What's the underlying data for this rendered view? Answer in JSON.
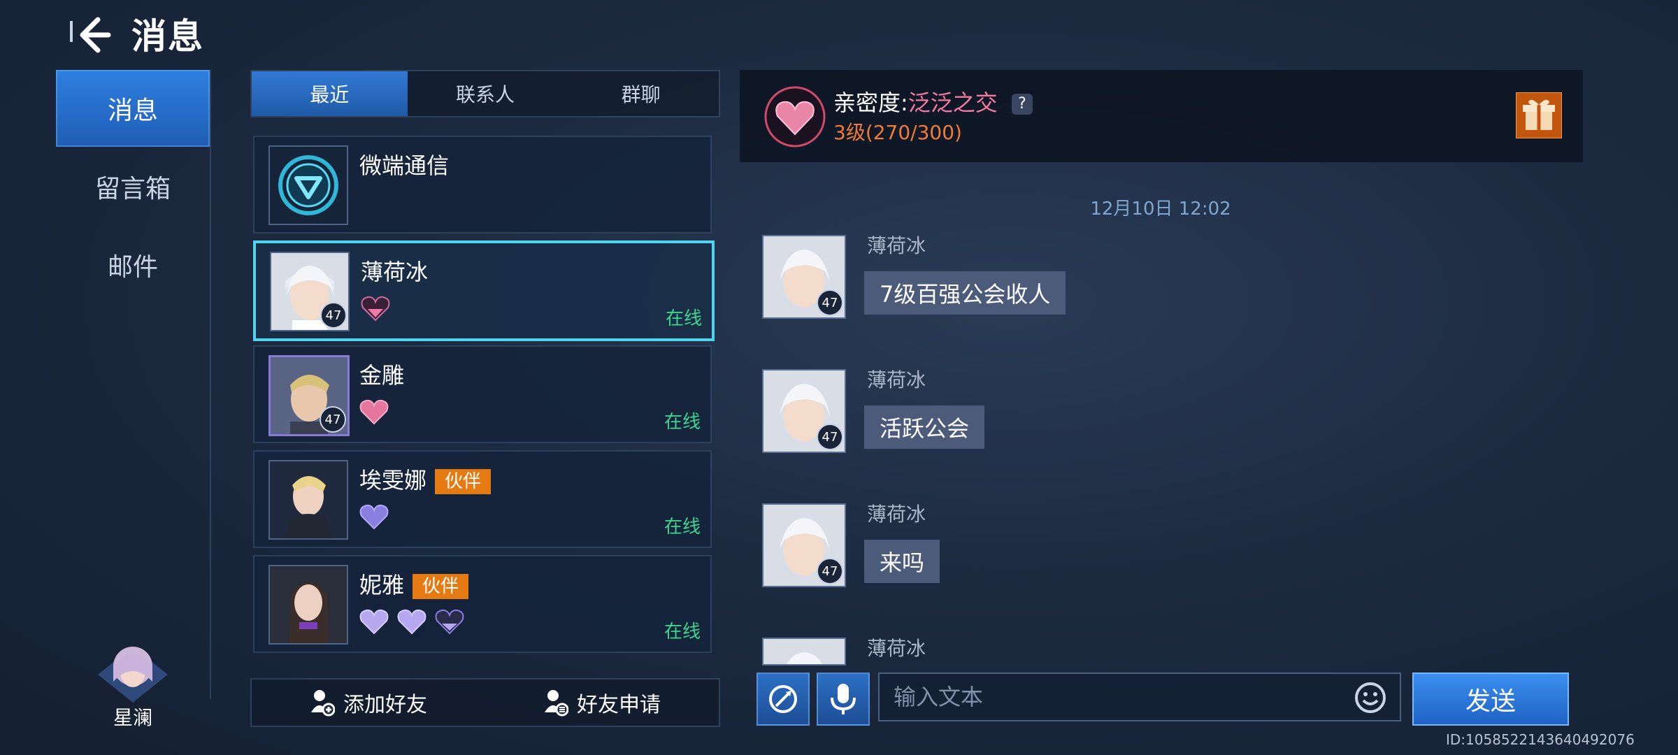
{
  "header": {
    "title": "消息"
  },
  "nav": {
    "items": [
      {
        "label": "消息"
      },
      {
        "label": "留言箱"
      },
      {
        "label": "邮件"
      }
    ]
  },
  "self": {
    "name": "星澜"
  },
  "tabs": [
    {
      "label": "最近"
    },
    {
      "label": "联系人"
    },
    {
      "label": "群聊"
    }
  ],
  "contacts": [
    {
      "name": "微端通信",
      "level": "",
      "tag": "",
      "status": ""
    },
    {
      "name": "薄荷冰",
      "level": "47",
      "tag": "",
      "status": "在线"
    },
    {
      "name": "金雕",
      "level": "47",
      "tag": "",
      "status": "在线"
    },
    {
      "name": "埃雯娜",
      "level": "",
      "tag": "伙伴",
      "status": "在线"
    },
    {
      "name": "妮雅",
      "level": "",
      "tag": "伙伴",
      "status": "在线"
    }
  ],
  "bottom": {
    "add_friend": "添加好友",
    "friend_request": "好友申请"
  },
  "intimacy": {
    "label": "亲密度:",
    "tier": "泛泛之交",
    "help": "?",
    "level": "3级(270/300)"
  },
  "chat": {
    "time": "12月10日 12:02",
    "messages": [
      {
        "name": "薄荷冰",
        "level": "47",
        "text": "7级百强公会收人"
      },
      {
        "name": "薄荷冰",
        "level": "47",
        "text": "活跃公会"
      },
      {
        "name": "薄荷冰",
        "level": "47",
        "text": "来吗"
      },
      {
        "name": "薄荷冰",
        "level": "",
        "text": ""
      }
    ]
  },
  "input": {
    "placeholder": "输入文本",
    "send": "发送"
  },
  "uid": "ID:1058522143640492076",
  "colors": {
    "accent": "#2e7fe0",
    "online": "#3ed48f",
    "tag": "#e67a12",
    "intimacy_tier": "#f37aa0",
    "intimacy_level": "#f07a3a"
  }
}
